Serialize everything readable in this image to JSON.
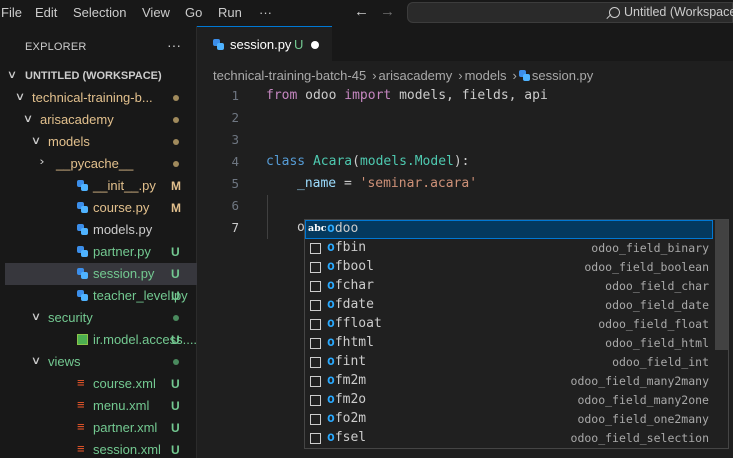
{
  "menu": [
    "File",
    "Edit",
    "Selection",
    "View",
    "Go",
    "Run",
    "···"
  ],
  "nav": {
    "back": "←",
    "forward": "→"
  },
  "search": {
    "text": "Untitled (Workspace)"
  },
  "sidebar": {
    "title": "EXPLORER",
    "more": "···",
    "items": [
      {
        "label": "UNTITLED (WORKSPACE)",
        "chevron": "∨",
        "color": "#cccccc"
      },
      {
        "label": "technical-training-b...",
        "chevron": "∨",
        "color": "#e2c08d",
        "status": "dot",
        "status_color": "#a08a5c"
      },
      {
        "label": "arisacademy",
        "chevron": "∨",
        "color": "#e2c08d",
        "status": "dot",
        "status_color": "#a08a5c"
      },
      {
        "label": "models",
        "chevron": "∨",
        "color": "#e2c08d",
        "status": "dot",
        "status_color": "#a08a5c"
      },
      {
        "label": "__pycache__",
        "chevron": "›",
        "color": "#e2c08d",
        "status": "dot",
        "status_color": "#a08a5c"
      },
      {
        "label": "__init__.py",
        "icon": "python-icon",
        "color": "#e2c08d",
        "status": "M",
        "status_color": "#e2c08d"
      },
      {
        "label": "course.py",
        "icon": "python-icon",
        "color": "#e2c08d",
        "status": "M",
        "status_color": "#e2c08d"
      },
      {
        "label": "models.py",
        "icon": "python-icon",
        "color": "#cccccc"
      },
      {
        "label": "partner.py",
        "icon": "python-icon",
        "color": "#73c991",
        "status": "U",
        "status_color": "#73c991"
      },
      {
        "label": "session.py",
        "icon": "python-icon",
        "color": "#73c991",
        "status": "U",
        "status_color": "#73c991"
      },
      {
        "label": "teacher_level.py",
        "icon": "python-icon",
        "color": "#73c991",
        "status": "U",
        "status_color": "#73c991"
      },
      {
        "label": "security",
        "chevron": "∨",
        "color": "#73c991",
        "status": "dot",
        "status_color": "#4a8a5e"
      },
      {
        "label": "ir.model.access....",
        "icon": "csv-icon",
        "color": "#73c991",
        "status": "U",
        "status_color": "#73c991"
      },
      {
        "label": "views",
        "chevron": "∨",
        "color": "#73c991",
        "status": "dot",
        "status_color": "#4a8a5e"
      },
      {
        "label": "course.xml",
        "icon": "xml-icon",
        "color": "#73c991",
        "status": "U",
        "status_color": "#73c991"
      },
      {
        "label": "menu.xml",
        "icon": "xml-icon",
        "color": "#73c991",
        "status": "U",
        "status_color": "#73c991"
      },
      {
        "label": "partner.xml",
        "icon": "xml-icon",
        "color": "#73c991",
        "status": "U",
        "status_color": "#73c991"
      },
      {
        "label": "session.xml",
        "icon": "xml-icon",
        "color": "#73c991",
        "status": "U",
        "status_color": "#73c991"
      }
    ]
  },
  "tab": {
    "name": "session.py",
    "status": "U"
  },
  "breadcrumb": [
    "technical-training-batch-45",
    "arisacademy",
    "models",
    "session.py"
  ],
  "code": {
    "line_numbers": [
      "1",
      "2",
      "3",
      "4",
      "5",
      "6",
      "7"
    ],
    "line1": {
      "kw1": "from",
      "mod": " odoo ",
      "kw2": "import",
      "rest": " models, fields, api"
    },
    "line4": {
      "kw": "class",
      "name": "Acara",
      "p1": "(",
      "base": "models.Model",
      "p2": "):"
    },
    "line5": {
      "var": "_name",
      "eq": " = ",
      "str": "'seminar.acara'"
    },
    "line7": {
      "text": "o"
    }
  },
  "suggest": {
    "items": [
      {
        "match": "o",
        "rest": "doo",
        "detail": "",
        "icon": "text-icon"
      },
      {
        "match": "o",
        "rest": "fbin",
        "detail": "odoo_field_binary",
        "icon": "snippet-icon"
      },
      {
        "match": "o",
        "rest": "fbool",
        "detail": "odoo_field_boolean",
        "icon": "snippet-icon"
      },
      {
        "match": "o",
        "rest": "fchar",
        "detail": "odoo_field_char",
        "icon": "snippet-icon"
      },
      {
        "match": "o",
        "rest": "fdate",
        "detail": "odoo_field_date",
        "icon": "snippet-icon"
      },
      {
        "match": "o",
        "rest": "ffloat",
        "detail": "odoo_field_float",
        "icon": "snippet-icon"
      },
      {
        "match": "o",
        "rest": "fhtml",
        "detail": "odoo_field_html",
        "icon": "snippet-icon"
      },
      {
        "match": "o",
        "rest": "fint",
        "detail": "odoo_field_int",
        "icon": "snippet-icon"
      },
      {
        "match": "o",
        "rest": "fm2m",
        "detail": "odoo_field_many2many",
        "icon": "snippet-icon"
      },
      {
        "match": "o",
        "rest": "fm2o",
        "detail": "odoo_field_many2one",
        "icon": "snippet-icon"
      },
      {
        "match": "o",
        "rest": "fo2m",
        "detail": "odoo_field_one2many",
        "icon": "snippet-icon"
      },
      {
        "match": "o",
        "rest": "fsel",
        "detail": "odoo_field_selection",
        "icon": "snippet-icon"
      }
    ],
    "text_icon_label": "abc"
  }
}
